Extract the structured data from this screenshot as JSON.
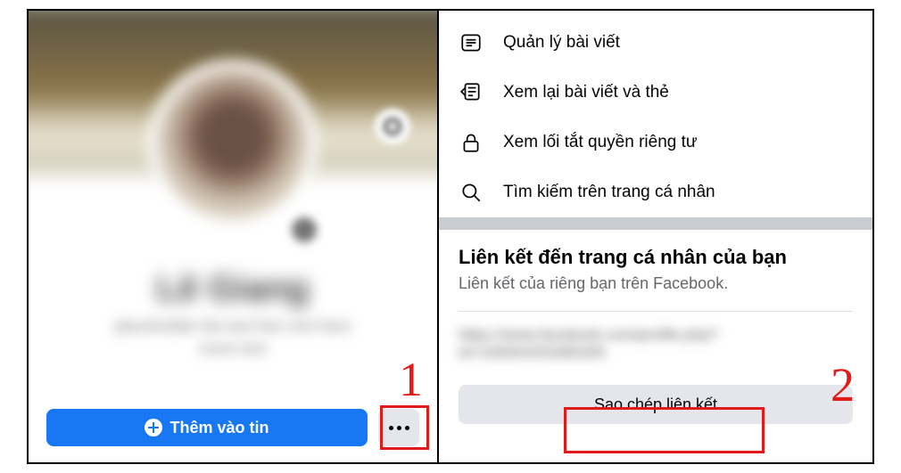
{
  "left": {
    "profile_name": "Lê Giang",
    "bio_line1": "placeholder bio text line one here",
    "bio_line2": "more text",
    "add_story_label": "Thêm vào tin",
    "marker": "1"
  },
  "right": {
    "menu": [
      {
        "icon": "list-icon",
        "label": "Quản lý bài viết"
      },
      {
        "icon": "review-icon",
        "label": "Xem lại bài viết và thẻ"
      },
      {
        "icon": "lock-icon",
        "label": "Xem lối tắt quyền riêng tư"
      },
      {
        "icon": "search-icon",
        "label": "Tìm kiếm trên trang cá nhân"
      }
    ],
    "section_title": "Liên kết đến trang cá nhân của bạn",
    "section_sub": "Liên kết của riêng bạn trên Facebook.",
    "url_blurred": "https://www.facebook.com/profile.php?id=100004453385305",
    "copy_label": "Sao chép liên kết",
    "marker": "2"
  }
}
